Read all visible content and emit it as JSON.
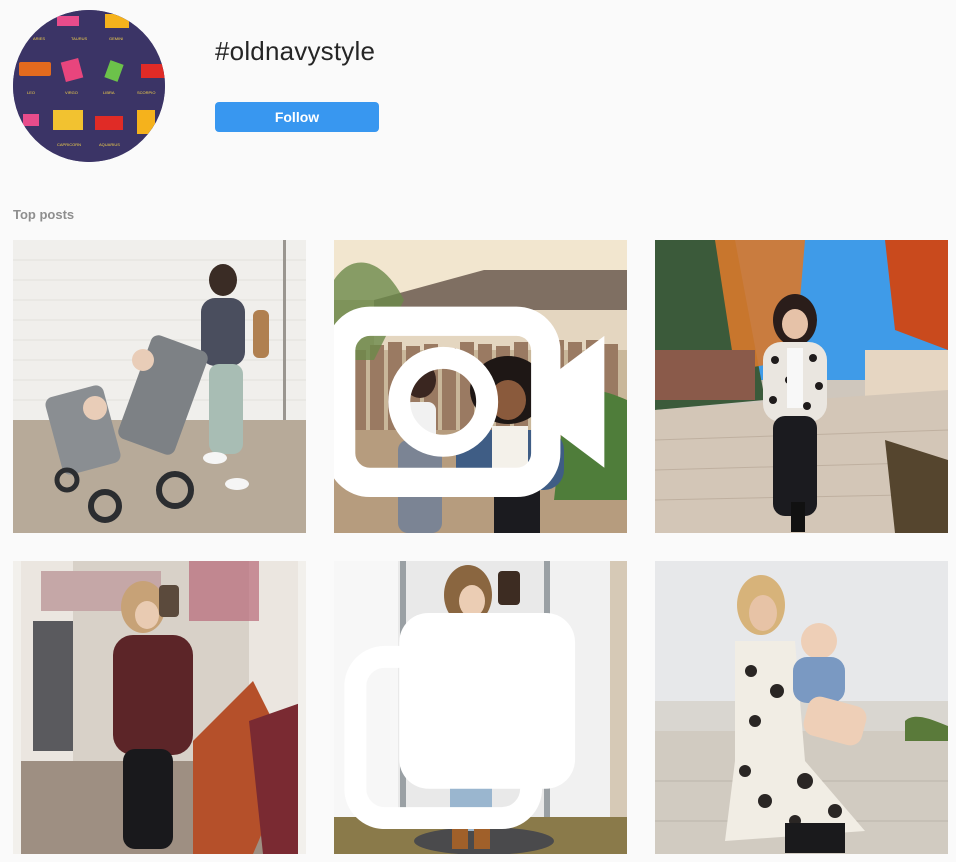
{
  "hashtag": {
    "title": "#oldnavystyle",
    "follow_label": "Follow"
  },
  "avatar": {
    "zodiac_labels": [
      "TAURUS",
      "GEMINI",
      "LEO",
      "VIRGO",
      "LIBRA",
      "SCORPIO",
      "CAPRICORN",
      "AQUARIUS"
    ],
    "candy_labels": [
      "TWIX",
      "JUJUBES",
      "ALMOND JOY",
      "REDHOTS",
      "SWEDISH"
    ]
  },
  "sections": {
    "top_posts_label": "Top posts"
  },
  "posts": [
    {
      "name": "post-mom-stroller",
      "badge": ""
    },
    {
      "name": "post-girls-fence",
      "badge": "video-icon"
    },
    {
      "name": "post-leopard-jacket",
      "badge": ""
    },
    {
      "name": "post-mirror-selfie-burgundy",
      "badge": ""
    },
    {
      "name": "post-mustard-coat",
      "badge": "carousel-icon"
    },
    {
      "name": "post-mother-baby-dress",
      "badge": ""
    }
  ],
  "colors": {
    "follow_bg": "#3897f0",
    "background": "#fafafa",
    "label_gray": "#8e8e8e"
  }
}
